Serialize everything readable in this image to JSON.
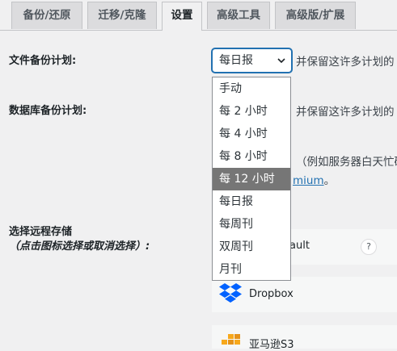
{
  "tabs": [
    {
      "label": "备份/还原"
    },
    {
      "label": "迁移/克隆"
    },
    {
      "label": "设置"
    },
    {
      "label": "高级工具"
    },
    {
      "label": "高级版/扩展"
    }
  ],
  "file_backup": {
    "label": "文件备份计划:",
    "selected": "每日报",
    "side_text": "并保留这许多计划的"
  },
  "db_backup": {
    "label": "数据库备份计划:",
    "side_text": "并保留这许多计划的"
  },
  "schedule_note": {
    "text": "（例如服务器白天忙碌",
    "link": "mium",
    "suffix": "。"
  },
  "dropdown": {
    "options": [
      "手动",
      "每 2 小时",
      "每 4 小时",
      "每 8 小时",
      "每 12 小时",
      "每日报",
      "每周刊",
      "双周刊",
      "月刊"
    ],
    "highlighted": "每 12 小时"
  },
  "remote_storage": {
    "label": "选择远程存储",
    "hint": "（点击图标选择或取消选择）:",
    "help": "?",
    "items": [
      {
        "label": "ault",
        "icon": "vault-icon"
      },
      {
        "label": "Dropbox",
        "icon": "dropbox-icon"
      },
      {
        "label": "亚马逊S3",
        "icon": "amazon-s3-icon"
      }
    ]
  },
  "colors": {
    "accent": "#2271b1",
    "highlight": "#767676",
    "dropbox": "#0061ff",
    "s3": "#f7a81b"
  }
}
